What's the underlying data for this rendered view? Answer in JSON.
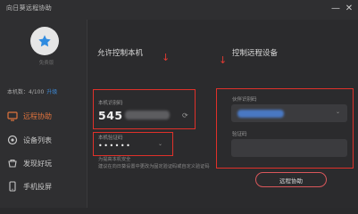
{
  "app": {
    "title": "向日葵远程协助"
  },
  "window_controls": {
    "minimize": "—",
    "close": "✕"
  },
  "sidebar": {
    "avatar_name": "免费版",
    "device_count": "本机数：4/100",
    "upgrade_link": "升级",
    "items": [
      {
        "label": "远程协助",
        "icon": "remote-assist-icon",
        "active": true
      },
      {
        "label": "设备列表",
        "icon": "device-list-icon",
        "active": false
      },
      {
        "label": "发现好玩",
        "icon": "discover-icon",
        "active": false
      },
      {
        "label": "手机投屏",
        "icon": "phone-cast-icon",
        "active": false
      }
    ]
  },
  "allow_control": {
    "title": "允许控制本机",
    "id_label": "本机识别码",
    "id_value": "545",
    "password_label": "本机验证码",
    "password_value": "••••••",
    "note_line1": "为提高本机安全",
    "note_line2": "建议在向日葵设置中更改为固定验证码或自定义验证码"
  },
  "remote_control": {
    "title": "控制远程设备",
    "id_label": "伙伴识别码",
    "verify_label": "验证码",
    "verify_placeholder": "",
    "button_label": "远程协助"
  },
  "colors": {
    "accent": "#e0733d",
    "highlight_box": "#e0312a",
    "link": "#3d8bd9"
  }
}
